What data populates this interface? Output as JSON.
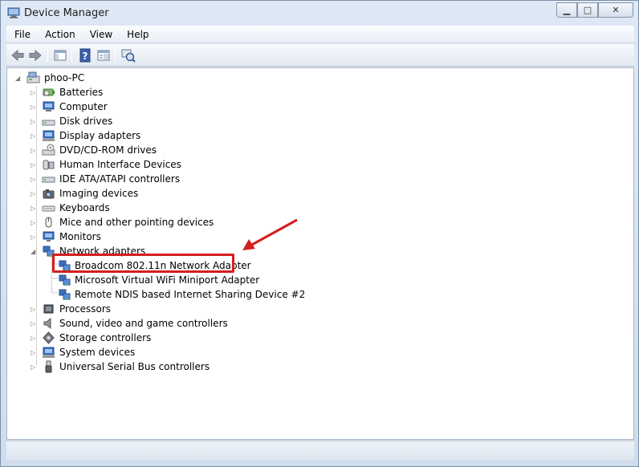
{
  "window": {
    "title": "Device Manager"
  },
  "caption_buttons": {
    "minimize_glyph": "▁",
    "maximize_glyph": "□",
    "close_glyph": "✕"
  },
  "menu": [
    "File",
    "Action",
    "View",
    "Help"
  ],
  "toolbar": {
    "buttons": [
      "back-icon",
      "forward-icon",
      "show-hide-console-tree-icon",
      "help-icon",
      "properties-icon",
      "scan-hardware-icon"
    ]
  },
  "tree": {
    "root": {
      "label": "phoo-PC",
      "expanded": true
    },
    "categories": [
      {
        "label": "Batteries",
        "icon": "battery-icon"
      },
      {
        "label": "Computer",
        "icon": "computer-icon"
      },
      {
        "label": "Disk drives",
        "icon": "disk-drive-icon"
      },
      {
        "label": "Display adapters",
        "icon": "display-adapter-icon"
      },
      {
        "label": "DVD/CD-ROM drives",
        "icon": "dvd-drive-icon"
      },
      {
        "label": "Human Interface Devices",
        "icon": "hid-icon"
      },
      {
        "label": "IDE ATA/ATAPI controllers",
        "icon": "ide-controller-icon"
      },
      {
        "label": "Imaging devices",
        "icon": "camera-icon"
      },
      {
        "label": "Keyboards",
        "icon": "keyboard-icon"
      },
      {
        "label": "Mice and other pointing devices",
        "icon": "mouse-icon"
      },
      {
        "label": "Monitors",
        "icon": "monitor-icon"
      },
      {
        "label": "Network adapters",
        "icon": "network-adapter-icon",
        "expanded": true,
        "children": [
          {
            "label": "Broadcom 802.11n Network Adapter",
            "highlighted": true
          },
          {
            "label": "Microsoft Virtual WiFi Miniport Adapter"
          },
          {
            "label": "Remote NDIS based Internet Sharing Device #2"
          }
        ]
      },
      {
        "label": "Processors",
        "icon": "processor-icon"
      },
      {
        "label": "Sound, video and game controllers",
        "icon": "speaker-icon"
      },
      {
        "label": "Storage controllers",
        "icon": "storage-icon"
      },
      {
        "label": "System devices",
        "icon": "system-device-icon"
      },
      {
        "label": "Universal Serial Bus controllers",
        "icon": "usb-icon"
      }
    ]
  },
  "annotation": {
    "color": "#d41f1f"
  }
}
